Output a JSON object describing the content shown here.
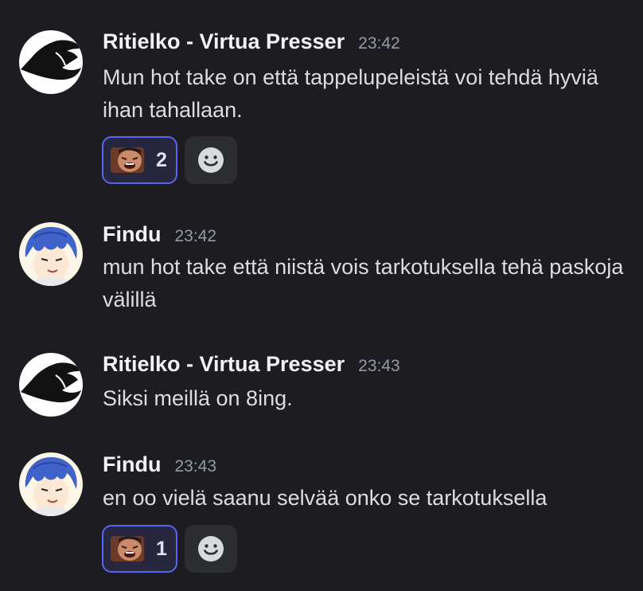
{
  "messages": [
    {
      "username": "Ritielko - Virtua Presser",
      "timestamp": "23:42",
      "text": "Mun hot take on että tappelupeleistä voi tehdä hyviä ihan tahallaan.",
      "reaction": {
        "count": "2"
      }
    },
    {
      "username": "Findu",
      "timestamp": "23:42",
      "text": "mun hot take että niistä vois tarkotuksella tehä paskoja välillä"
    },
    {
      "username": "Ritielko - Virtua Presser",
      "timestamp": "23:43",
      "text": "Siksi meillä on 8ing."
    },
    {
      "username": "Findu",
      "timestamp": "23:43",
      "text": "en oo vielä saanu selvää onko se tarkotuksella",
      "reaction": {
        "count": "1"
      }
    }
  ],
  "icons": {
    "hat_avatar": "black-hat-avatar",
    "anime_avatar": "blue-hair-anime-avatar",
    "custom_emoji": "laughing-face-emoji",
    "add_reaction": "smiley-add-reaction-icon"
  },
  "colors": {
    "background": "#1c1c21",
    "username": "#f2f3f5",
    "timestamp": "#949ba4",
    "text": "#dbdee1",
    "reaction_bg": "#26273f",
    "reaction_border": "#5865f2",
    "add_reaction_bg": "#2b2d31"
  }
}
